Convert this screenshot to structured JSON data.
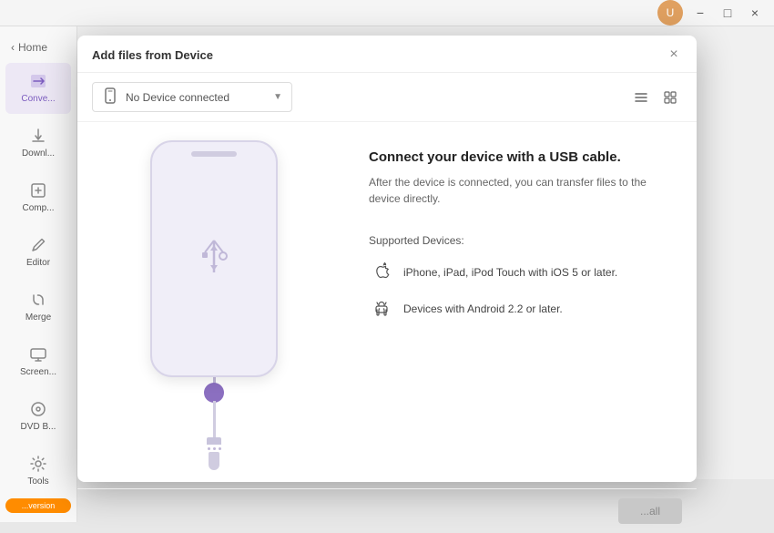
{
  "topbar": {
    "minimize_label": "−",
    "maximize_label": "□",
    "close_label": "×"
  },
  "sidebar": {
    "back_label": "Home",
    "items": [
      {
        "id": "convert",
        "label": "Conve...",
        "active": true
      },
      {
        "id": "download",
        "label": "Downl...",
        "active": false
      },
      {
        "id": "compress",
        "label": "Comp...",
        "active": false
      },
      {
        "id": "editor",
        "label": "Editor",
        "active": false
      },
      {
        "id": "merge",
        "label": "Merge",
        "active": false
      },
      {
        "id": "screen",
        "label": "Screen...",
        "active": false
      },
      {
        "id": "dvd",
        "label": "DVD B...",
        "active": false
      },
      {
        "id": "tools",
        "label": "Tools",
        "active": false
      }
    ],
    "upgrade_label": "...version"
  },
  "dialog": {
    "title": "Add files from Device",
    "device_selector": {
      "placeholder": "No Device connected",
      "icon": "📱"
    },
    "phone_illustration": {
      "usb_symbol": "↕"
    },
    "info": {
      "title": "Connect your device with a USB cable.",
      "description": "After the device is connected, you can transfer files to the device directly.",
      "supported_label": "Supported Devices:",
      "devices": [
        {
          "id": "ios",
          "label": "iPhone, iPad, iPod Touch with iOS 5 or later."
        },
        {
          "id": "android",
          "label": "Devices with Android 2.2 or later."
        }
      ]
    },
    "footer": {
      "add_all_label": "...all"
    }
  }
}
